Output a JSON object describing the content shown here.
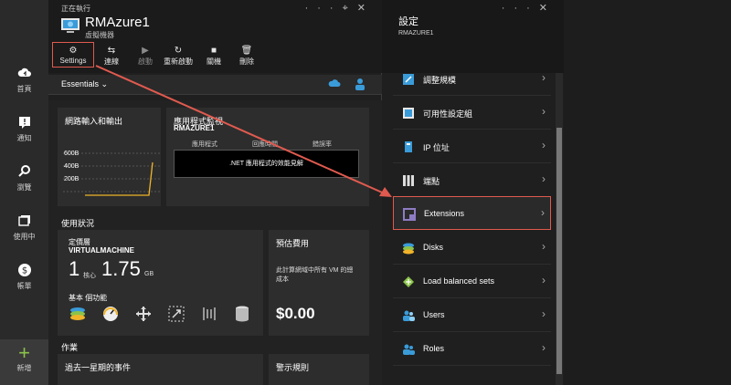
{
  "leftnav": {
    "items": [
      {
        "label": "首頁",
        "icon": "cloud-home-icon"
      },
      {
        "label": "通知",
        "icon": "notification-icon"
      },
      {
        "label": "瀏覽",
        "icon": "browse-icon"
      },
      {
        "label": "使用中",
        "icon": "active-icon"
      },
      {
        "label": "帳單",
        "icon": "billing-icon"
      }
    ],
    "new_label": "新增"
  },
  "blade1": {
    "status": "正在執行",
    "title": "RMAzure1",
    "subtitle": "虛擬機器",
    "toolbar": {
      "settings": "Settings",
      "connect": "連線",
      "start": "啟動",
      "restart": "重新啟動",
      "shutdown": "關機",
      "delete": "刪除"
    },
    "essentials": "Essentials",
    "network_tile": {
      "title": "網路輸入和輸出",
      "y_ticks": [
        "600B",
        "400B",
        "200B"
      ]
    },
    "monitor_tile": {
      "title": "應用程式監視",
      "subtitle": "RMAZURE1",
      "columns": [
        "應用程式",
        "回應時間",
        "錯誤率"
      ],
      "box_text": ".NET 應用程式的效能見解"
    },
    "usage_section": "使用狀況",
    "pricing_tile": {
      "tier_label": "定價層",
      "tier_value": "VIRTUALMACHINE",
      "cores_value": "1",
      "cores_unit": "核心",
      "memory_value": "1.75",
      "memory_unit": "GB",
      "features_label": "基本 個功能"
    },
    "estimate_tile": {
      "title": "預估費用",
      "text": "此計算網域中所有 VM 的總成本",
      "price": "$0.00"
    },
    "operations_section": "作業",
    "events_title": "過去一星期的事件",
    "alerts_title": "警示規則"
  },
  "blade2": {
    "title": "設定",
    "subtitle": "RMAZURE1",
    "items": [
      {
        "label": "調整規模",
        "icon": "scale-icon"
      },
      {
        "label": "可用性設定組",
        "icon": "availability-set-icon"
      },
      {
        "label": "IP 位址",
        "icon": "ip-address-icon"
      },
      {
        "label": "端點",
        "icon": "endpoints-icon"
      },
      {
        "label": "Extensions",
        "icon": "extensions-icon"
      },
      {
        "label": "Disks",
        "icon": "disks-icon"
      },
      {
        "label": "Load balanced sets",
        "icon": "load-balancer-icon"
      },
      {
        "label": "Users",
        "icon": "users-icon"
      },
      {
        "label": "Roles",
        "icon": "roles-icon"
      }
    ]
  },
  "colors": {
    "highlight": "#e05a4f",
    "accent_blue": "#3a9bd9",
    "chart_line": "#f0b429"
  }
}
